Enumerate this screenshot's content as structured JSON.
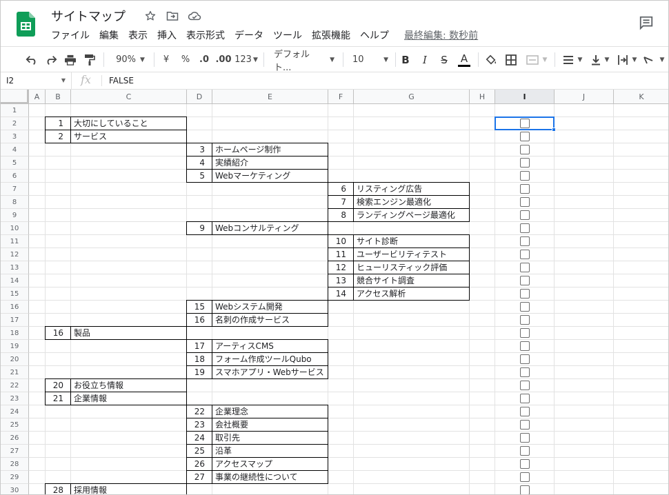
{
  "doc": {
    "title": "サイトマップ"
  },
  "menu": [
    "ファイル",
    "編集",
    "表示",
    "挿入",
    "表示形式",
    "データ",
    "ツール",
    "拡張機能",
    "ヘルプ"
  ],
  "last_edit": "最終編集: 数秒前",
  "toolbar": {
    "zoom": "90%",
    "currency": "¥",
    "percent": "%",
    "dec_decrease": ".0",
    "dec_increase": ".00",
    "format_more": "123",
    "font": "デフォルト...",
    "font_size": "10",
    "bold": "B",
    "italic": "I",
    "strike": "S",
    "text_color": "A"
  },
  "formula_bar": {
    "cell_ref": "I2",
    "fx": "fx",
    "value": "FALSE"
  },
  "columns": [
    "A",
    "B",
    "C",
    "D",
    "E",
    "F",
    "G",
    "H",
    "I",
    "J",
    "K"
  ],
  "selected_column": "I",
  "rows": [
    "1",
    "2",
    "3",
    "4",
    "5",
    "6",
    "7",
    "8",
    "9",
    "10",
    "11",
    "12",
    "13",
    "14",
    "15",
    "16",
    "17",
    "18",
    "19",
    "20",
    "21",
    "22",
    "23",
    "24",
    "25",
    "26",
    "27",
    "28",
    "29",
    "30"
  ],
  "entries": [
    {
      "row": 2,
      "level": 1,
      "num": "1",
      "label": "大切にしていること"
    },
    {
      "row": 3,
      "level": 1,
      "num": "2",
      "label": "サービス"
    },
    {
      "row": 4,
      "level": 2,
      "num": "3",
      "label": "ホームページ制作"
    },
    {
      "row": 5,
      "level": 2,
      "num": "4",
      "label": "実績紹介"
    },
    {
      "row": 6,
      "level": 2,
      "num": "5",
      "label": "Webマーケティング"
    },
    {
      "row": 7,
      "level": 3,
      "num": "6",
      "label": "リスティング広告"
    },
    {
      "row": 8,
      "level": 3,
      "num": "7",
      "label": "検索エンジン最適化"
    },
    {
      "row": 9,
      "level": 3,
      "num": "8",
      "label": "ランディングページ最適化"
    },
    {
      "row": 10,
      "level": 2,
      "num": "9",
      "label": "Webコンサルティング"
    },
    {
      "row": 11,
      "level": 3,
      "num": "10",
      "label": "サイト診断"
    },
    {
      "row": 12,
      "level": 3,
      "num": "11",
      "label": "ユーザービリティテスト"
    },
    {
      "row": 13,
      "level": 3,
      "num": "12",
      "label": "ヒューリスティック評価"
    },
    {
      "row": 14,
      "level": 3,
      "num": "13",
      "label": "競合サイト調査"
    },
    {
      "row": 15,
      "level": 3,
      "num": "14",
      "label": "アクセス解析"
    },
    {
      "row": 16,
      "level": 2,
      "num": "15",
      "label": "Webシステム開発"
    },
    {
      "row": 17,
      "level": 2,
      "num": "16",
      "label": "名刺の作成サービス"
    },
    {
      "row": 18,
      "level": 1,
      "num": "16",
      "label": "製品"
    },
    {
      "row": 19,
      "level": 2,
      "num": "17",
      "label": "アーティスCMS"
    },
    {
      "row": 20,
      "level": 2,
      "num": "18",
      "label": "フォーム作成ツールQubo"
    },
    {
      "row": 21,
      "level": 2,
      "num": "19",
      "label": "スマホアプリ・Webサービス"
    },
    {
      "row": 22,
      "level": 1,
      "num": "20",
      "label": "お役立ち情報"
    },
    {
      "row": 23,
      "level": 1,
      "num": "21",
      "label": "企業情報"
    },
    {
      "row": 24,
      "level": 2,
      "num": "22",
      "label": "企業理念"
    },
    {
      "row": 25,
      "level": 2,
      "num": "23",
      "label": "会社概要"
    },
    {
      "row": 26,
      "level": 2,
      "num": "24",
      "label": "取引先"
    },
    {
      "row": 27,
      "level": 2,
      "num": "25",
      "label": "沿革"
    },
    {
      "row": 28,
      "level": 2,
      "num": "26",
      "label": "アクセスマップ"
    },
    {
      "row": 29,
      "level": 2,
      "num": "27",
      "label": "事業の継続性について"
    },
    {
      "row": 30,
      "level": 1,
      "num": "28",
      "label": "採用情報"
    }
  ],
  "checkbox_rows": [
    2,
    3,
    4,
    5,
    6,
    7,
    8,
    9,
    10,
    11,
    12,
    13,
    14,
    15,
    16,
    17,
    18,
    19,
    20,
    21,
    22,
    23,
    24,
    25,
    26,
    27,
    28,
    29,
    30
  ],
  "colors": {
    "accent": "#1a73e8",
    "sheets_green": "#0f9d58"
  }
}
